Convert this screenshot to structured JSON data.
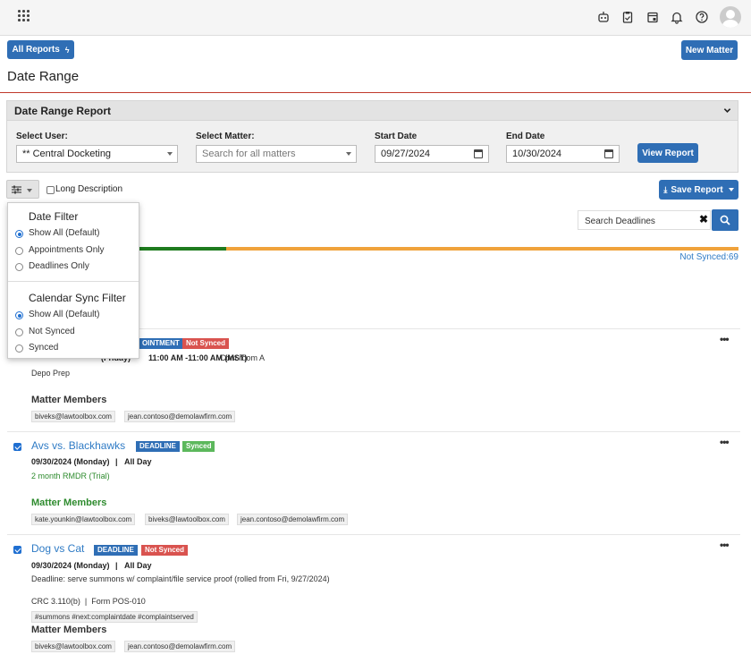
{
  "topbar": {
    "icons": [
      "apps-grid-icon",
      "robot-icon",
      "clipboard-check-icon",
      "calendar-add-icon",
      "bell-icon",
      "help-icon",
      "user-avatar-icon"
    ]
  },
  "header": {
    "all_reports_label": "All Reports",
    "new_matter_label": "New Matter",
    "page_title": "Date Range"
  },
  "report_panel": {
    "title": "Date Range Report",
    "select_user_label": "Select User:",
    "select_user_value": "** Central Docketing",
    "select_matter_label": "Select Matter:",
    "select_matter_placeholder": "Search for all matters",
    "start_date_label": "Start Date",
    "start_date_value": "09/27/2024",
    "end_date_label": "End Date",
    "end_date_value": "10/30/2024",
    "view_report_label": "View Report"
  },
  "toolbar": {
    "long_description_label": "Long Description",
    "save_report_label": "Save Report",
    "search_placeholder": "Search Deadlines",
    "not_synced_count_text": "Not Synced:69",
    "synced_fraction": 0.3
  },
  "filter_dropdown": {
    "date_filter_heading": "Date Filter",
    "date_options": [
      "Show All (Default)",
      "Appointments Only",
      "Deadlines Only"
    ],
    "date_selected": 0,
    "sync_filter_heading": "Calendar Sync Filter",
    "sync_options": [
      "Show All (Default)",
      "Not Synced",
      "Synced"
    ],
    "sync_selected": 0
  },
  "cards": [
    {
      "type_badge": "APPOINTMENT",
      "type_badge_visible_text": "OINTMENT",
      "sync_badge": "Not Synced",
      "date_fragment": "(Friday)",
      "time": "11:00 AM -11:00 AM (MST)",
      "location": "Conf room A",
      "description": "Depo Prep",
      "members_heading": "Matter Members",
      "members": [
        "biveks@lawtoolbox.com",
        "jean.contoso@demolawfirm.com"
      ]
    },
    {
      "title": "Avs vs. Blackhawks",
      "type_badge": "DEADLINE",
      "sync_badge": "Synced",
      "date": "09/30/2024 (Monday)",
      "separator": "|",
      "when": "All Day",
      "description": "2 month RMDR (Trial)",
      "members_heading": "Matter Members",
      "members": [
        "kate.younkin@lawtoolbox.com",
        "biveks@lawtoolbox.com",
        "jean.contoso@demolawfirm.com"
      ]
    },
    {
      "title": "Dog vs Cat",
      "type_badge": "DEADLINE",
      "sync_badge": "Not Synced",
      "date": "09/30/2024 (Monday)",
      "separator": "|",
      "when": "All Day",
      "description": "Deadline: serve summons w/ complaint/file service proof (rolled from Fri, 9/27/2024)",
      "rule": "CRC 3.110(b)  |  Form POS-010",
      "hashtags": "#summons #next:complaintdate #complaintserved",
      "members_heading": "Matter Members",
      "members": [
        "biveks@lawtoolbox.com",
        "jean.contoso@demolawfirm.com"
      ]
    }
  ],
  "colors": {
    "brand_blue": "#2f6eb5",
    "synced_green": "#1e7b1e",
    "not_synced_orange": "#f0a23b",
    "badge_red": "#d9534f",
    "badge_green": "#5cb85c",
    "header_red_line": "#c0392b"
  }
}
